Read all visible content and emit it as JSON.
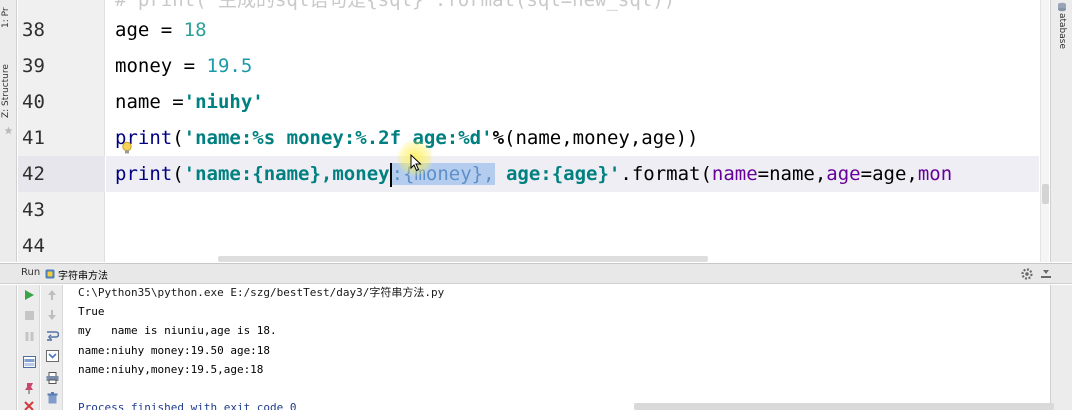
{
  "editor": {
    "comment_text": "# print('生成的sql语句是{sql}'.format(sql=new_sql))",
    "line_numbers": [
      "38",
      "39",
      "40",
      "41",
      "42",
      "43",
      "44"
    ],
    "line38": {
      "var": "age",
      "op": " = ",
      "value": "18"
    },
    "line39": {
      "var": "money",
      "op": " = ",
      "value": "19.5"
    },
    "line40": {
      "var": "name",
      "op": " =",
      "value": "'niuhy'"
    },
    "line41": {
      "func": "print",
      "open": "(",
      "str_a": "'name:",
      "str_pct1": "%s",
      "str_b": " money:",
      "str_pct2": "%.2f",
      "str_c": " age:",
      "str_pct3": "%d",
      "str_d": "'",
      "op": "%",
      "args": "(name,money,age))"
    },
    "line42": {
      "func": "print",
      "open": "(",
      "str_a": "'name:{name},mon",
      "str_b": "ey",
      "selected": ":{money},",
      "str_c": " age:{age}'",
      "method": ".format(",
      "kw1": "name",
      "eq1": "=name,",
      "kw2": "age",
      "eq2": "=age,",
      "kw3": "mon"
    }
  },
  "sidebars": {
    "project_label": "1: Pr",
    "structure_label": "Z: Structure",
    "database_label": "atabase"
  },
  "run_panel": {
    "title": "Run",
    "tab_label": "字符串方法",
    "console_lines": [
      "C:\\Python35\\python.exe E:/szg/bestTest/day3/字符串方法.py",
      "True",
      "my   name is niuniu,age is 18.",
      "name:niuhy money:19.50 age:18",
      "name:niuhy,money:19.5,age:18",
      "",
      "Process finished with exit code 0"
    ]
  },
  "colors": {
    "keyword": "#000080",
    "number": "#2aa198",
    "string": "#008080",
    "named_arg": "#660099",
    "selection": "#b4cdee",
    "current_line": "#eeeef4"
  }
}
